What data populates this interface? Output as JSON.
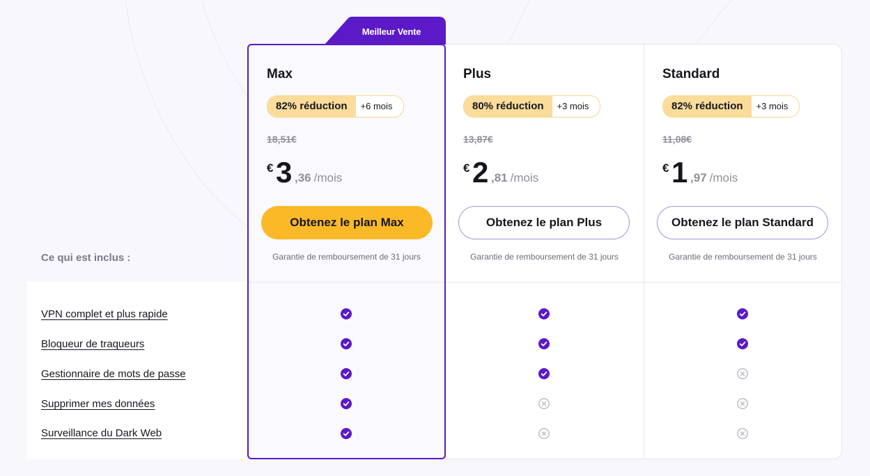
{
  "included_label": "Ce qui est inclus :",
  "features": [
    "VPN complet et plus rapide",
    "Bloqueur de traqueurs",
    "Gestionnaire de mots de passe",
    "Supprimer mes données",
    "Surveillance du Dark Web"
  ],
  "best_seller": "Meilleur Vente",
  "currency": "€",
  "per_month": "/mois",
  "plans": [
    {
      "name": "Max",
      "discount": "82% réduction",
      "bonus": "+6 mois",
      "old_price": "18,51€",
      "price_int": "3",
      "price_dec": ",36",
      "cta": "Obtenez le plan Max",
      "guarantee": "Garantie de remboursement de 31 jours",
      "included": [
        true,
        true,
        true,
        true,
        true
      ]
    },
    {
      "name": "Plus",
      "discount": "80% réduction",
      "bonus": "+3 mois",
      "old_price": "13,87€",
      "price_int": "2",
      "price_dec": ",81",
      "cta": "Obtenez le plan Plus",
      "guarantee": "Garantie de remboursement de 31 jours",
      "included": [
        true,
        true,
        true,
        false,
        false
      ]
    },
    {
      "name": "Standard",
      "discount": "82% réduction",
      "bonus": "+3 mois",
      "old_price": "11,08€",
      "price_int": "1",
      "price_dec": ",97",
      "cta": "Obtenez le plan Standard",
      "guarantee": "Garantie de remboursement de 31 jours",
      "included": [
        true,
        true,
        false,
        false,
        false
      ]
    }
  ],
  "colors": {
    "accent": "#5b19c8",
    "cta_primary": "#fbb927",
    "badge": "#fbdc9b",
    "check": "#5b19c8",
    "cross": "#b9b9c2"
  },
  "icons": {
    "included": "check-circle-icon",
    "excluded": "x-circle-icon"
  }
}
